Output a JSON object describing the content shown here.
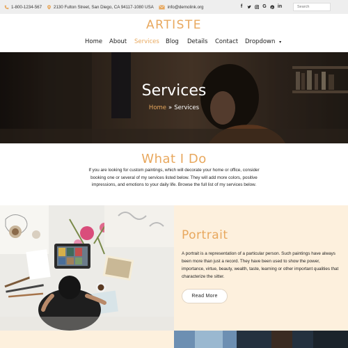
{
  "topbar": {
    "phone": "1-800-1234-567",
    "address": "2130 Fulton Street, San Diego, CA 94117-1080 USA",
    "email": "info@demolink.org",
    "socials": [
      "facebook-icon",
      "twitter-icon",
      "instagram-icon",
      "google-icon",
      "pinterest-icon",
      "linkedin-icon"
    ],
    "search_placeholder": "Search"
  },
  "header": {
    "logo": "ARTISTE"
  },
  "nav": {
    "items": [
      "Home",
      "About",
      "Services",
      "Blog",
      "Details",
      "Contact",
      "Dropdown"
    ],
    "active": "Services",
    "dropdown_caret": "⌄"
  },
  "hero": {
    "title": "Services",
    "breadcrumb_home": "Home",
    "breadcrumb_sep": "»",
    "breadcrumb_current": "Services"
  },
  "what_i_do": {
    "title": "What I Do",
    "text": "If you are looking for custom paintings, which will decorate your home or office, consider booking one or several of my services listed below. They will add more colors, positive impressions, and emotions to your daily life. Browse the full list of my services below."
  },
  "portrait": {
    "title": "Portrait",
    "text": "A portrait is a representation of a particular person. Such paintings have always been more than just a record. They have been used to show the power, importance, virtue, beauty, wealth, taste, learning or other important qualities that characterize the sitter.",
    "button": "Read More"
  },
  "colors": {
    "accent": "#e8a85e",
    "topbar_bg": "#eeeeee",
    "panel_bg": "#fdf0dd"
  }
}
